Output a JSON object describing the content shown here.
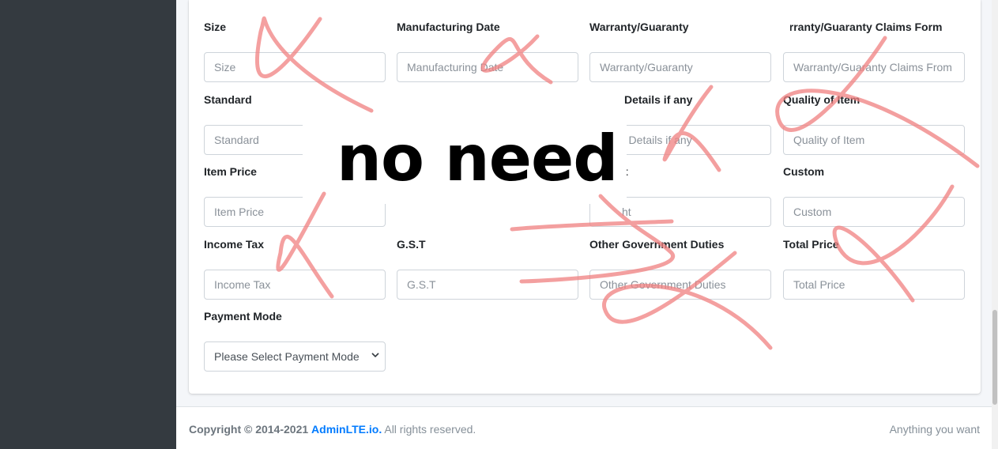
{
  "form": {
    "fields": [
      {
        "label": "Size",
        "placeholder": "Size"
      },
      {
        "label": "Manufacturing Date",
        "placeholder": "Manufacturing Date"
      },
      {
        "label": "Warranty/Guaranty",
        "placeholder": "Warranty/Guaranty"
      },
      {
        "label": "arranty/Guaranty Claims Form",
        "placeholder": "Warranty/Guaranty Claims From"
      },
      {
        "label": "Standard",
        "placeholder": "Standard"
      },
      {
        "label": "Details if any",
        "placeholder": "r Details if any"
      },
      {
        "label": "Quality of Item",
        "placeholder": "Quality of Item"
      },
      {
        "label": "Item Price",
        "placeholder": "Item Price"
      },
      {
        "label": "t",
        "placeholder": "ht"
      },
      {
        "label": "Custom",
        "placeholder": "Custom"
      },
      {
        "label": "Income Tax",
        "placeholder": "Income Tax"
      },
      {
        "label": "G.S.T",
        "placeholder": "G.S.T"
      },
      {
        "label": "Other Government Duties",
        "placeholder": "Other Government Duties"
      },
      {
        "label": "Total Price",
        "placeholder": "Total Price"
      }
    ],
    "payment_mode": {
      "label": "Payment Mode",
      "selected": "Please Select Payment Mode"
    }
  },
  "annotation": {
    "text": "no need",
    "color": "#f08080"
  },
  "footer": {
    "copyright_prefix": "Copyright © 2014-2021",
    "brand_link": "AdminLTE.io.",
    "rights": "All rights reserved.",
    "right_text": "Anything you want"
  }
}
